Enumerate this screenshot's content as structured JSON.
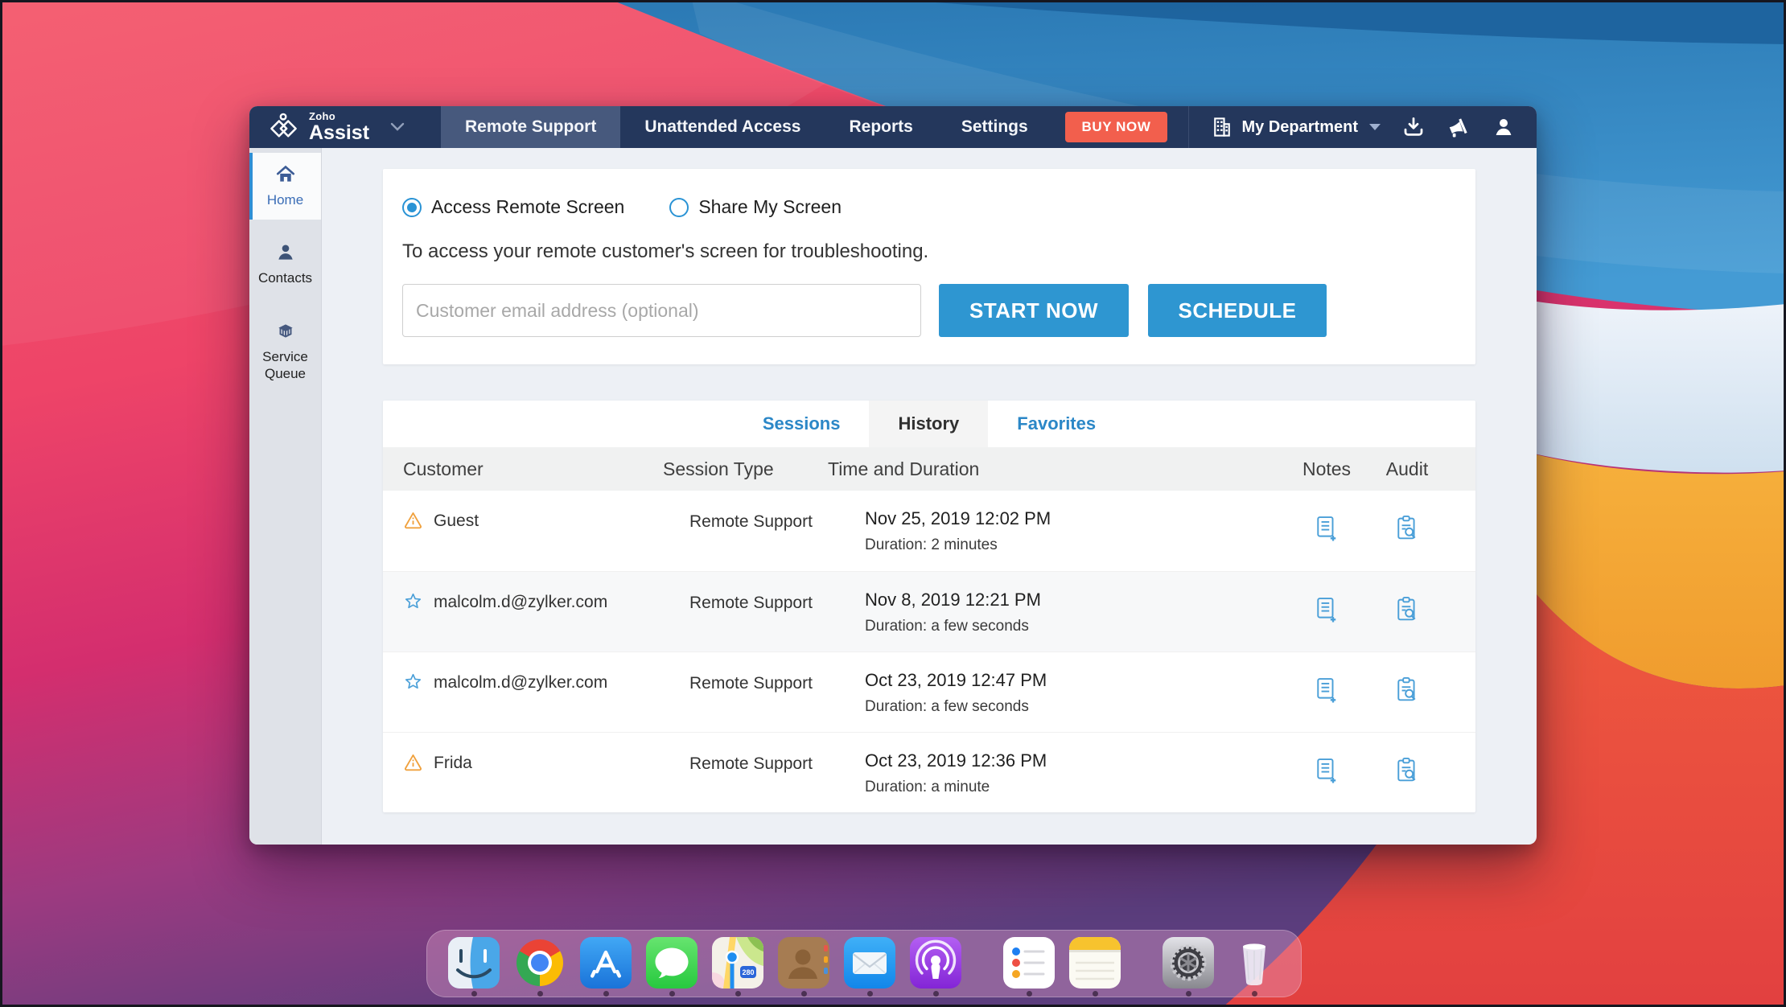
{
  "navbar": {
    "brand": {
      "small": "Zoho",
      "large": "Assist"
    },
    "tabs": [
      {
        "label": "Remote Support",
        "active": true
      },
      {
        "label": "Unattended Access",
        "active": false
      },
      {
        "label": "Reports",
        "active": false
      },
      {
        "label": "Settings",
        "active": false
      }
    ],
    "buy_now": "BUY NOW",
    "department": "My Department"
  },
  "sidebar": {
    "items": [
      {
        "label": "Home",
        "icon": "home-icon",
        "active": true
      },
      {
        "label": "Contacts",
        "icon": "contacts-icon",
        "active": false
      },
      {
        "label": "Service Queue",
        "icon": "service-queue-icon",
        "active": false
      }
    ]
  },
  "access_panel": {
    "radios": [
      {
        "label": "Access Remote Screen",
        "selected": true
      },
      {
        "label": "Share My Screen",
        "selected": false
      }
    ],
    "description": "To access your remote customer's screen for troubleshooting.",
    "email_placeholder": "Customer email address (optional)",
    "start_button": "START NOW",
    "schedule_button": "SCHEDULE"
  },
  "sessions_panel": {
    "tabs": [
      {
        "label": "Sessions",
        "active": false
      },
      {
        "label": "History",
        "active": true
      },
      {
        "label": "Favorites",
        "active": false
      }
    ],
    "columns": [
      "Customer",
      "Session Type",
      "Time and Duration",
      "Notes",
      "Audit"
    ],
    "rows": [
      {
        "icon": "alert-icon",
        "customer": "Guest",
        "session_type": "Remote Support",
        "time": "Nov 25, 2019 12:02 PM",
        "duration": "Duration: 2 minutes"
      },
      {
        "icon": "star-icon",
        "customer": "malcolm.d@zylker.com",
        "session_type": "Remote Support",
        "time": "Nov 8, 2019 12:21 PM",
        "duration": "Duration: a few seconds"
      },
      {
        "icon": "star-icon",
        "customer": "malcolm.d@zylker.com",
        "session_type": "Remote Support",
        "time": "Oct 23, 2019 12:47 PM",
        "duration": "Duration: a few seconds"
      },
      {
        "icon": "alert-icon",
        "customer": "Frida",
        "session_type": "Remote Support",
        "time": "Oct 23, 2019 12:36 PM",
        "duration": "Duration: a minute"
      }
    ]
  },
  "dock": {
    "items": [
      {
        "name": "Finder"
      },
      {
        "name": "Google Chrome"
      },
      {
        "name": "App Store"
      },
      {
        "name": "Messages"
      },
      {
        "name": "Maps"
      },
      {
        "name": "Contacts"
      },
      {
        "name": "Mail"
      },
      {
        "name": "Podcasts"
      },
      {
        "name": "Reminders"
      },
      {
        "name": "Notes"
      },
      {
        "name": "System Preferences"
      },
      {
        "name": "Trash"
      }
    ]
  },
  "colors": {
    "navbar_navy": "#24375c",
    "accent_blue": "#2e96d1",
    "buy_now_red": "#f25f4d",
    "link_blue": "#2b87c7",
    "alert_orange": "#f0a13e"
  }
}
